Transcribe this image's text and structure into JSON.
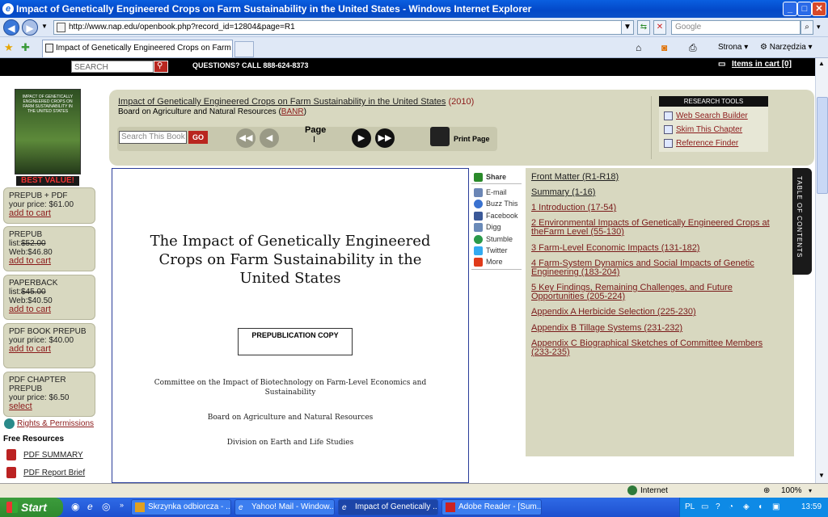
{
  "window": {
    "title": "Impact of Genetically Engineered Crops on Farm Sustainability in the United States - Windows Internet Explorer",
    "controls": {
      "minimize": "_",
      "maximize": "□",
      "close": "✕"
    }
  },
  "nav": {
    "url": "http://www.nap.edu/openbook.php?record_id=12804&page=R1",
    "search_placeholder": "Google"
  },
  "tab": {
    "label": "Impact of Genetically Engineered Crops on Farm Sust..."
  },
  "toolbar": {
    "page_label": "Strona",
    "tools_label": "Narzędzia"
  },
  "site": {
    "search_placeholder": "SEARCH",
    "questions": "QUESTIONS?  CALL 888-624-8373",
    "cart": "Items in cart [0]"
  },
  "sidebar": {
    "best_value": "BEST VALUE!",
    "cover_text": "IMPACT OF GENETICALLY ENGINEERED CROPS ON FARM SUSTAINABILITY IN THE UNITED STATES",
    "prices": [
      {
        "title": "PREPUB + PDF",
        "line1": "your price: $61.00",
        "line2": "",
        "action": "add to cart"
      },
      {
        "title": "PREPUB",
        "list": "list:",
        "list_price": "$52.00",
        "line2": "Web:$46.80",
        "action": "add to cart"
      },
      {
        "title": "PAPERBACK",
        "list": "list:",
        "list_price": "$45.00",
        "line2": "Web:$40.50",
        "action": "add to cart"
      },
      {
        "title": "PDF BOOK PREPUB",
        "line1": "your price: $40.00",
        "line2": "",
        "action": "add to cart"
      },
      {
        "title": "PDF CHAPTER PREPUB",
        "line1": "your price: $6.50",
        "line2": "",
        "action": "select"
      }
    ],
    "rights": "Rights & Permissions",
    "free_resources": "Free Resources",
    "pdf_summary": "PDF SUMMARY",
    "pdf_brief": "PDF Report Brief"
  },
  "book": {
    "title": "Impact of Genetically Engineered Crops on Farm Sustainability in the United States",
    "year": "(2010)",
    "board_prefix": "Board on Agriculture and Natural Resources (",
    "board_link": "BANR",
    "board_suffix": ")",
    "search_placeholder": "Search This Book",
    "go": "GO",
    "page_label": "Page",
    "page_number": "I",
    "print": "Print Page"
  },
  "research": {
    "header": "RESEARCH TOOLS",
    "items": [
      "Web Search Builder",
      "Skim This Chapter",
      "Reference Finder"
    ]
  },
  "document": {
    "title": "The Impact of Genetically Engineered Crops on Farm Sustainability in the United States",
    "prepub": "PREPUBLICATION COPY",
    "committee": "Committee on the Impact of Biotechnology on Farm-Level Economics and Sustainability",
    "board": "Board on Agriculture and Natural Resources",
    "division": "Division on Earth and Life Studies"
  },
  "share": {
    "header": "Share",
    "items": [
      "E-mail",
      "Buzz This",
      "Facebook",
      "Digg",
      "Stumble",
      "Twitter",
      "More"
    ]
  },
  "toc": {
    "tab_label": "TABLE OF CONTENTS",
    "items": [
      "Front Matter (R1-R18)",
      "Summary (1-16)",
      "1 Introduction (17-54)",
      "2 Environmental Impacts of Genetically Engineered Crops at theFarm Level (55-130)",
      "3 Farm-Level Economic Impacts (131-182)",
      "4 Farm-System Dynamics and Social Impacts of Genetic Engineering (183-204)",
      "5 Key Findings, Remaining Challenges, and Future Opportunities (205-224)",
      "Appendix A Herbicide Selection (225-230)",
      "Appendix B Tillage Systems (231-232)",
      "Appendix C Biographical Sketches of Committee Members (233-235)"
    ]
  },
  "status": {
    "zone": "Internet",
    "zoom": "100%"
  },
  "taskbar": {
    "start": "Start",
    "tasks": [
      "Skrzynka odbiorcza - ...",
      "Yahoo! Mail - Window...",
      "Impact of Genetically ...",
      "Adobe Reader - [Sum..."
    ],
    "lang": "PL",
    "time": "13:59"
  }
}
